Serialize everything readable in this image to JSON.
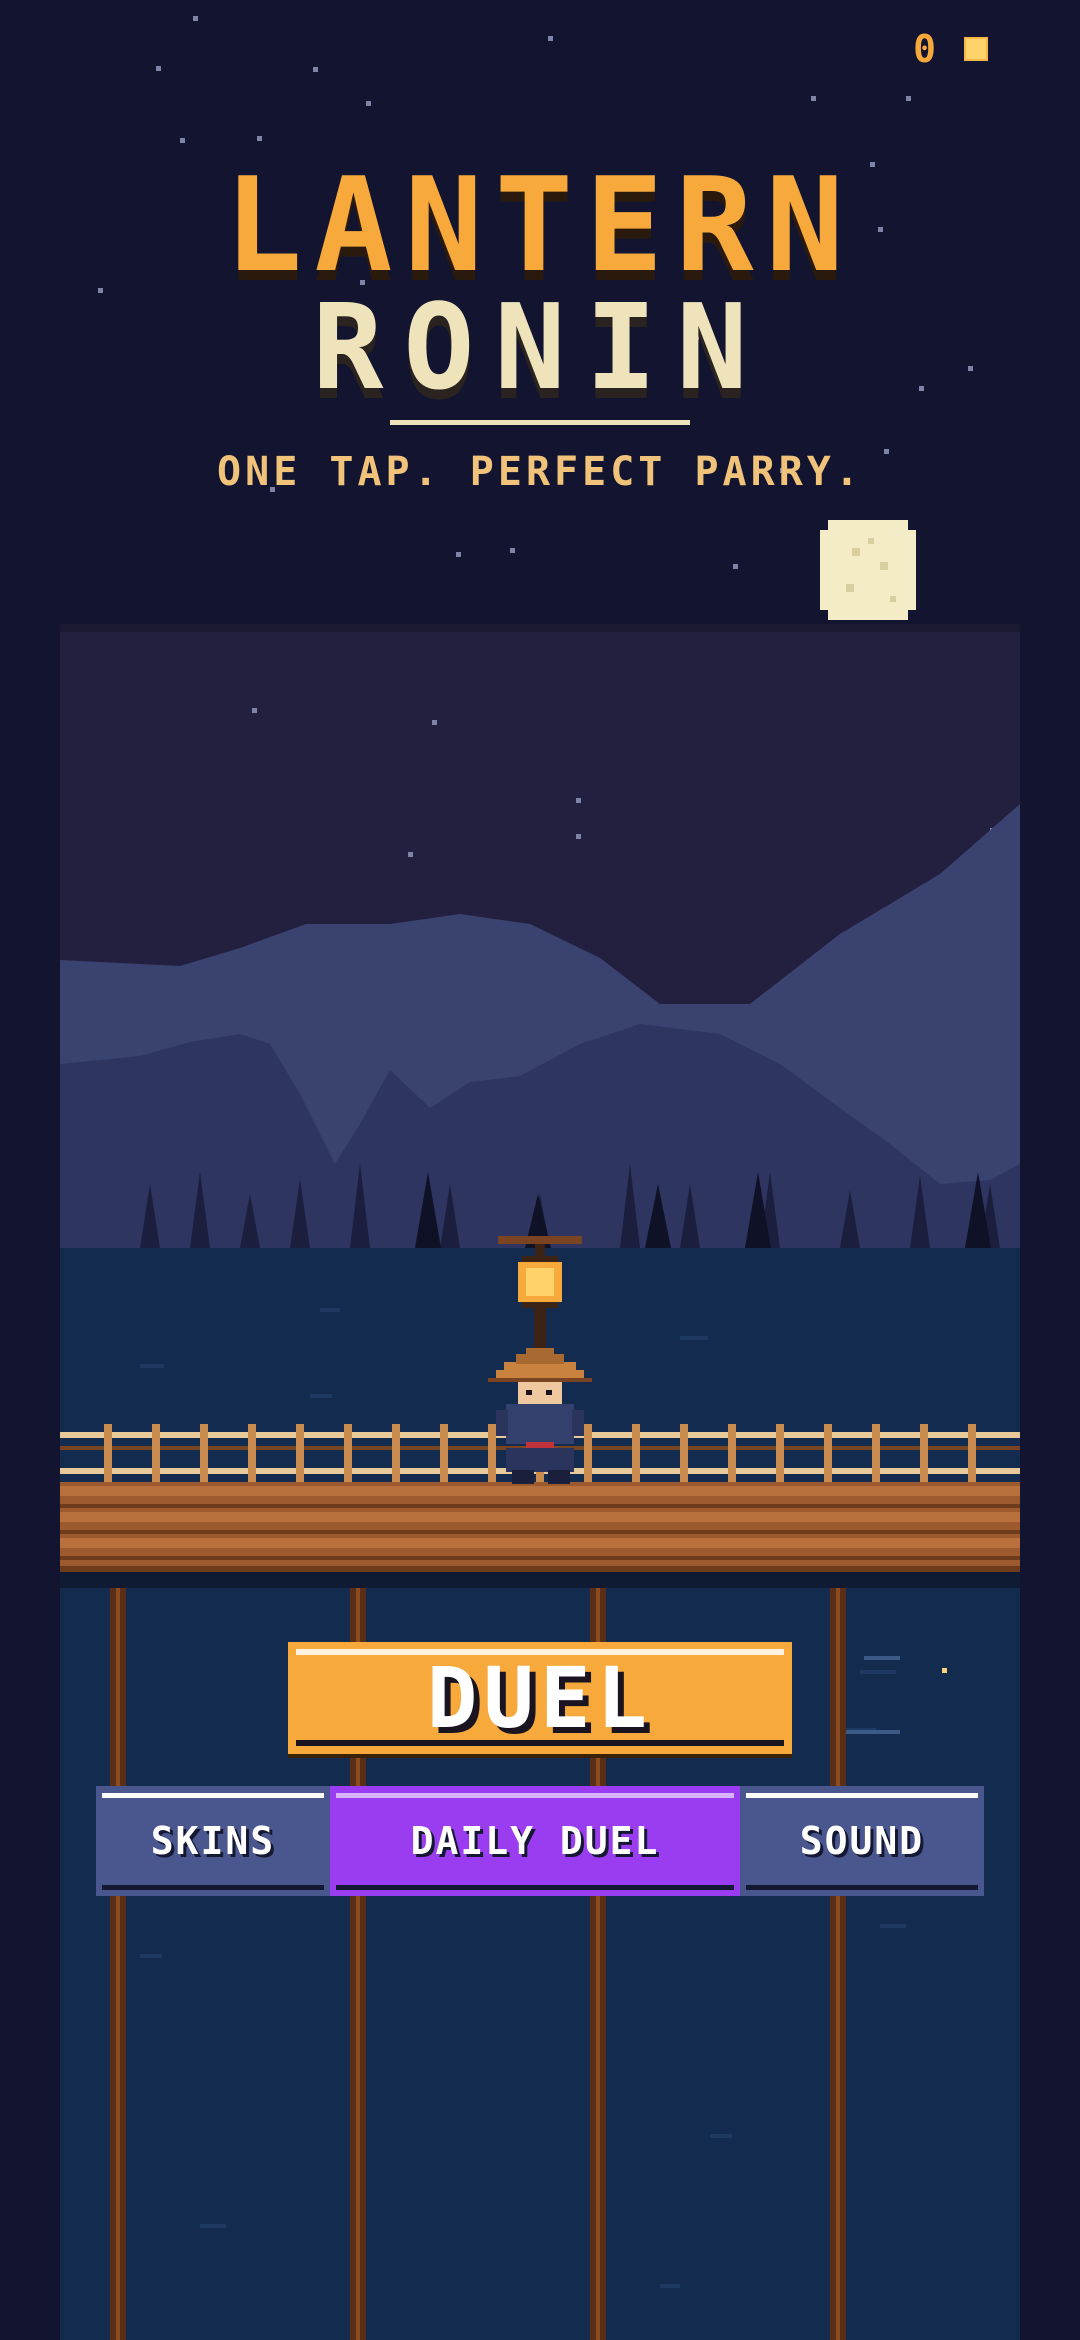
{
  "hud": {
    "coins": "0"
  },
  "title": {
    "line1": "LANTERN",
    "line2": "RONIN",
    "tagline": "ONE TAP. PERFECT PARRY."
  },
  "actions": {
    "primary": "DUEL"
  },
  "menu": [
    {
      "label": "SKINS",
      "selected": false
    },
    {
      "label": "DAILY DUEL",
      "selected": true
    },
    {
      "label": "SOUND",
      "selected": false
    }
  ],
  "colors": {
    "accent_orange": "#f7a93b",
    "cream": "#efe3bc",
    "selected_purple": "#9a3df0",
    "button_blue": "#4a568e",
    "night_sky": "#121430",
    "water": "#132b4e",
    "moon": "#f3ecc7"
  },
  "icons": [
    "coin-icon",
    "moon-icon",
    "lantern-icon"
  ]
}
